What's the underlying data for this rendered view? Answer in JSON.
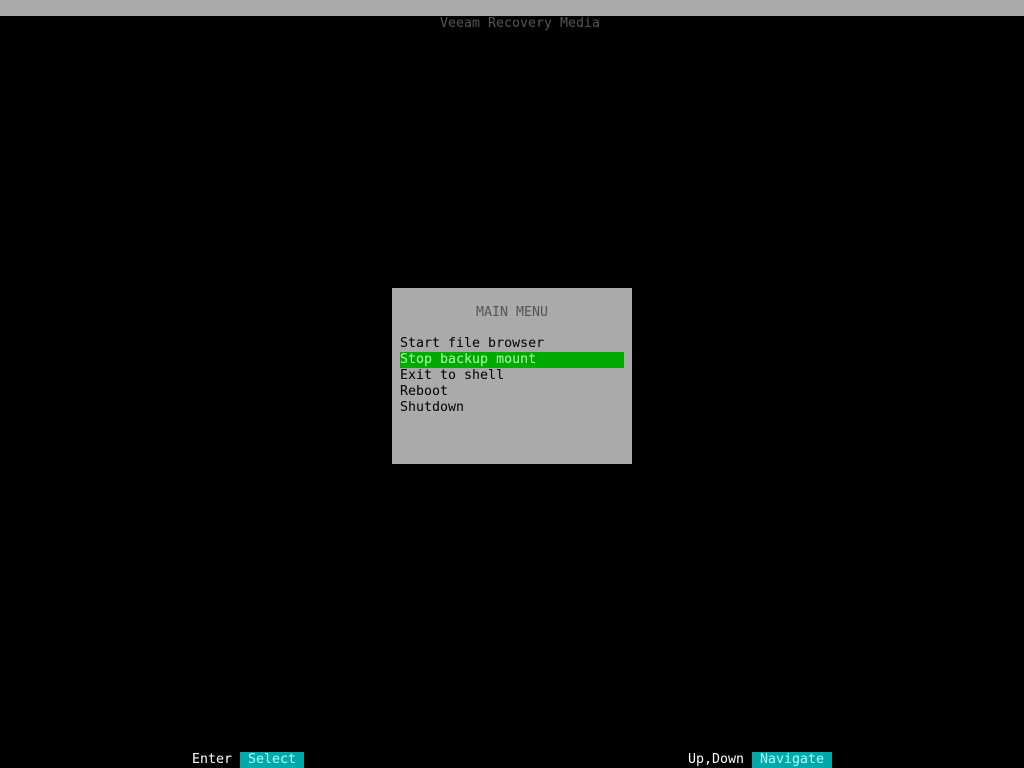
{
  "window": {
    "title": "Veeam Recovery Media"
  },
  "menu": {
    "title": "MAIN MENU",
    "selected_index": 1,
    "items": [
      {
        "label": "Start file browser"
      },
      {
        "label": "Stop backup mount"
      },
      {
        "label": "Exit to shell"
      },
      {
        "label": "Reboot"
      },
      {
        "label": "Shutdown"
      }
    ]
  },
  "footer": {
    "select_hint": {
      "key": "Enter",
      "action": "Select"
    },
    "navigate_hint": {
      "key": "Up,Down",
      "action": "Navigate"
    }
  },
  "colors": {
    "background": "#000000",
    "panel": "#aaaaaa",
    "selected_bg": "#00aa00",
    "hint_bg": "#00aaaa"
  }
}
